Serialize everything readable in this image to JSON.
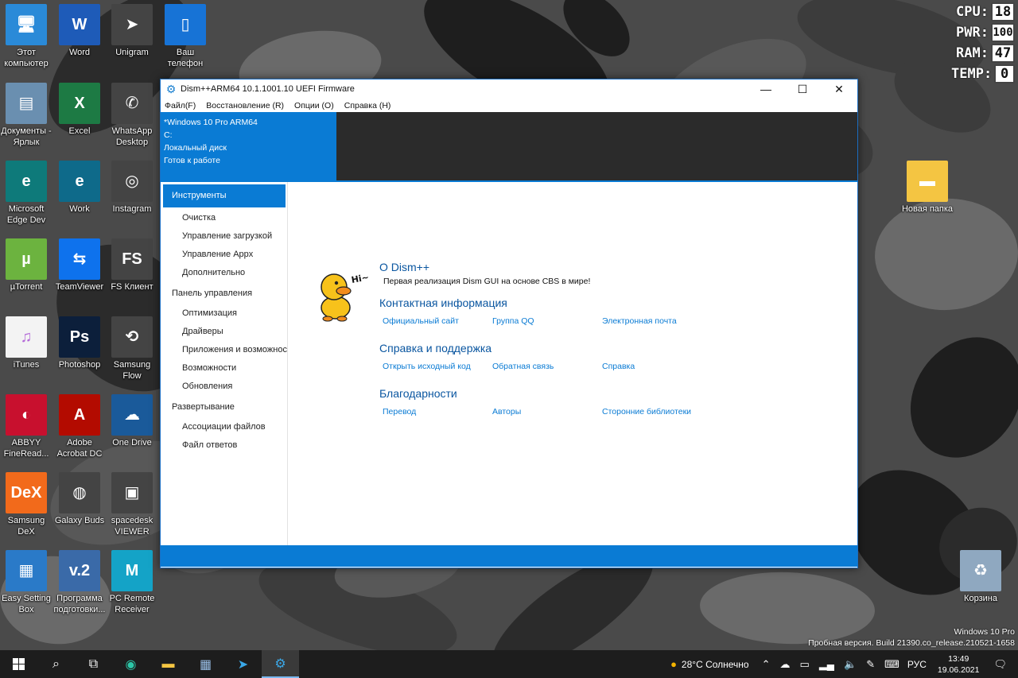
{
  "desktop": {
    "icons": [
      {
        "label": "Этот компьютер",
        "glyph": "🖥",
        "color": "#2a8ad8"
      },
      {
        "label": "Word",
        "glyph": "W",
        "color": "#1e5bb8"
      },
      {
        "label": "Unigram",
        "glyph": "➤",
        "color": "#444444"
      },
      {
        "label": "Ваш телефон",
        "glyph": "▯",
        "color": "#1773d6"
      },
      {
        "label": "Документы - Ярлык",
        "glyph": "▤",
        "color": "#6a8fb0"
      },
      {
        "label": "Excel",
        "glyph": "X",
        "color": "#1d7a44"
      },
      {
        "label": "WhatsApp Desktop",
        "glyph": "✆",
        "color": "#444444"
      },
      {
        "label": "Microsoft Edge Dev",
        "glyph": "e",
        "color": "#0e7a7a"
      },
      {
        "label": "Work",
        "glyph": "e",
        "color": "#0e6a8a"
      },
      {
        "label": "Instagram",
        "glyph": "◎",
        "color": "#444444"
      },
      {
        "label": "µTorrent",
        "glyph": "µ",
        "color": "#6cb33f"
      },
      {
        "label": "TeamViewer",
        "glyph": "⇆",
        "color": "#0e72ed"
      },
      {
        "label": "FS Клиент",
        "glyph": "FS",
        "color": "#444444"
      },
      {
        "label": "iTunes",
        "glyph": "♫",
        "color": "#f3f3f3"
      },
      {
        "label": "Photoshop",
        "glyph": "Ps",
        "color": "#0c1f3b"
      },
      {
        "label": "Samsung Flow",
        "glyph": "⟲",
        "color": "#444444"
      },
      {
        "label": "ABBYY FineRead...",
        "glyph": "◐",
        "color": "#c8102e"
      },
      {
        "label": "Adobe Acrobat DC",
        "glyph": "A",
        "color": "#b30b00"
      },
      {
        "label": "One Drive",
        "glyph": "☁",
        "color": "#1a5a9a"
      },
      {
        "label": "Samsung DeX",
        "glyph": "DeX",
        "color": "#f26a1b"
      },
      {
        "label": "Galaxy Buds",
        "glyph": "◍",
        "color": "#444444"
      },
      {
        "label": "spacedesk VIEWER",
        "glyph": "▣",
        "color": "#444444"
      },
      {
        "label": "Easy Setting Box",
        "glyph": "▦",
        "color": "#2a7ac8"
      },
      {
        "label": "Программа подготовки...",
        "glyph": "v.2",
        "color": "#3a6aa8"
      },
      {
        "label": "PC Remote Receiver",
        "glyph": "M",
        "color": "#14a3c7"
      },
      {
        "label": "Новая папка",
        "glyph": "▬",
        "color": "#f4c542"
      },
      {
        "label": "Корзина",
        "glyph": "♻",
        "color": "#8fa8c0"
      }
    ]
  },
  "monitor": {
    "rows": [
      {
        "label": "CPU:",
        "value": "18"
      },
      {
        "label": "PWR:",
        "value": "100"
      },
      {
        "label": "RAM:",
        "value": "47"
      },
      {
        "label": "TEMP:",
        "value": "0"
      }
    ]
  },
  "window": {
    "title": "Dism++ARM64 10.1.1001.10 UEFI Firmware",
    "menu": [
      "Файл(F)",
      "Восстановление (R)",
      "Опции (O)",
      "Справка (H)"
    ],
    "image_card": {
      "name": "*Windows 10 Pro ARM64",
      "drive": "C:",
      "disk": "Локальный диск",
      "status": "Готов к работе"
    },
    "sidebar": {
      "active": "Инструменты",
      "tools": [
        "Очистка",
        "Управление загрузкой",
        "Управление Appx",
        "Дополнительно"
      ],
      "control_panel": "Панель управления",
      "control_items": [
        "Оптимизация",
        "Драйверы",
        "Приложения и возможности",
        "Возможности",
        "Обновления"
      ],
      "deploy": "Развертывание",
      "deploy_items": [
        "Ассоциации файлов",
        "Файл ответов"
      ]
    },
    "about": {
      "greeting": "Hi~",
      "title": "О Dism++",
      "subtitle": "Первая реализация Dism GUI на основе CBS в мире!",
      "contact_title": "Контактная информация",
      "contact_links": [
        "Официальный сайт",
        "Группа QQ",
        "Электронная почта"
      ],
      "help_title": "Справка и поддержка",
      "help_links": [
        "Открыть исходный код",
        "Обратная связь",
        "Справка"
      ],
      "thanks_title": "Благодарности",
      "thanks_links": [
        "Перевод",
        "Авторы",
        "Сторонние библиотеки"
      ]
    }
  },
  "watermark": {
    "line1": "Windows 10 Pro",
    "line2": "Пробная версия. Build 21390.co_release.210521-1658"
  },
  "taskbar": {
    "weather": "28°C  Солнечно",
    "lang": "РУС",
    "time": "13:49",
    "date": "19.06.2021"
  }
}
